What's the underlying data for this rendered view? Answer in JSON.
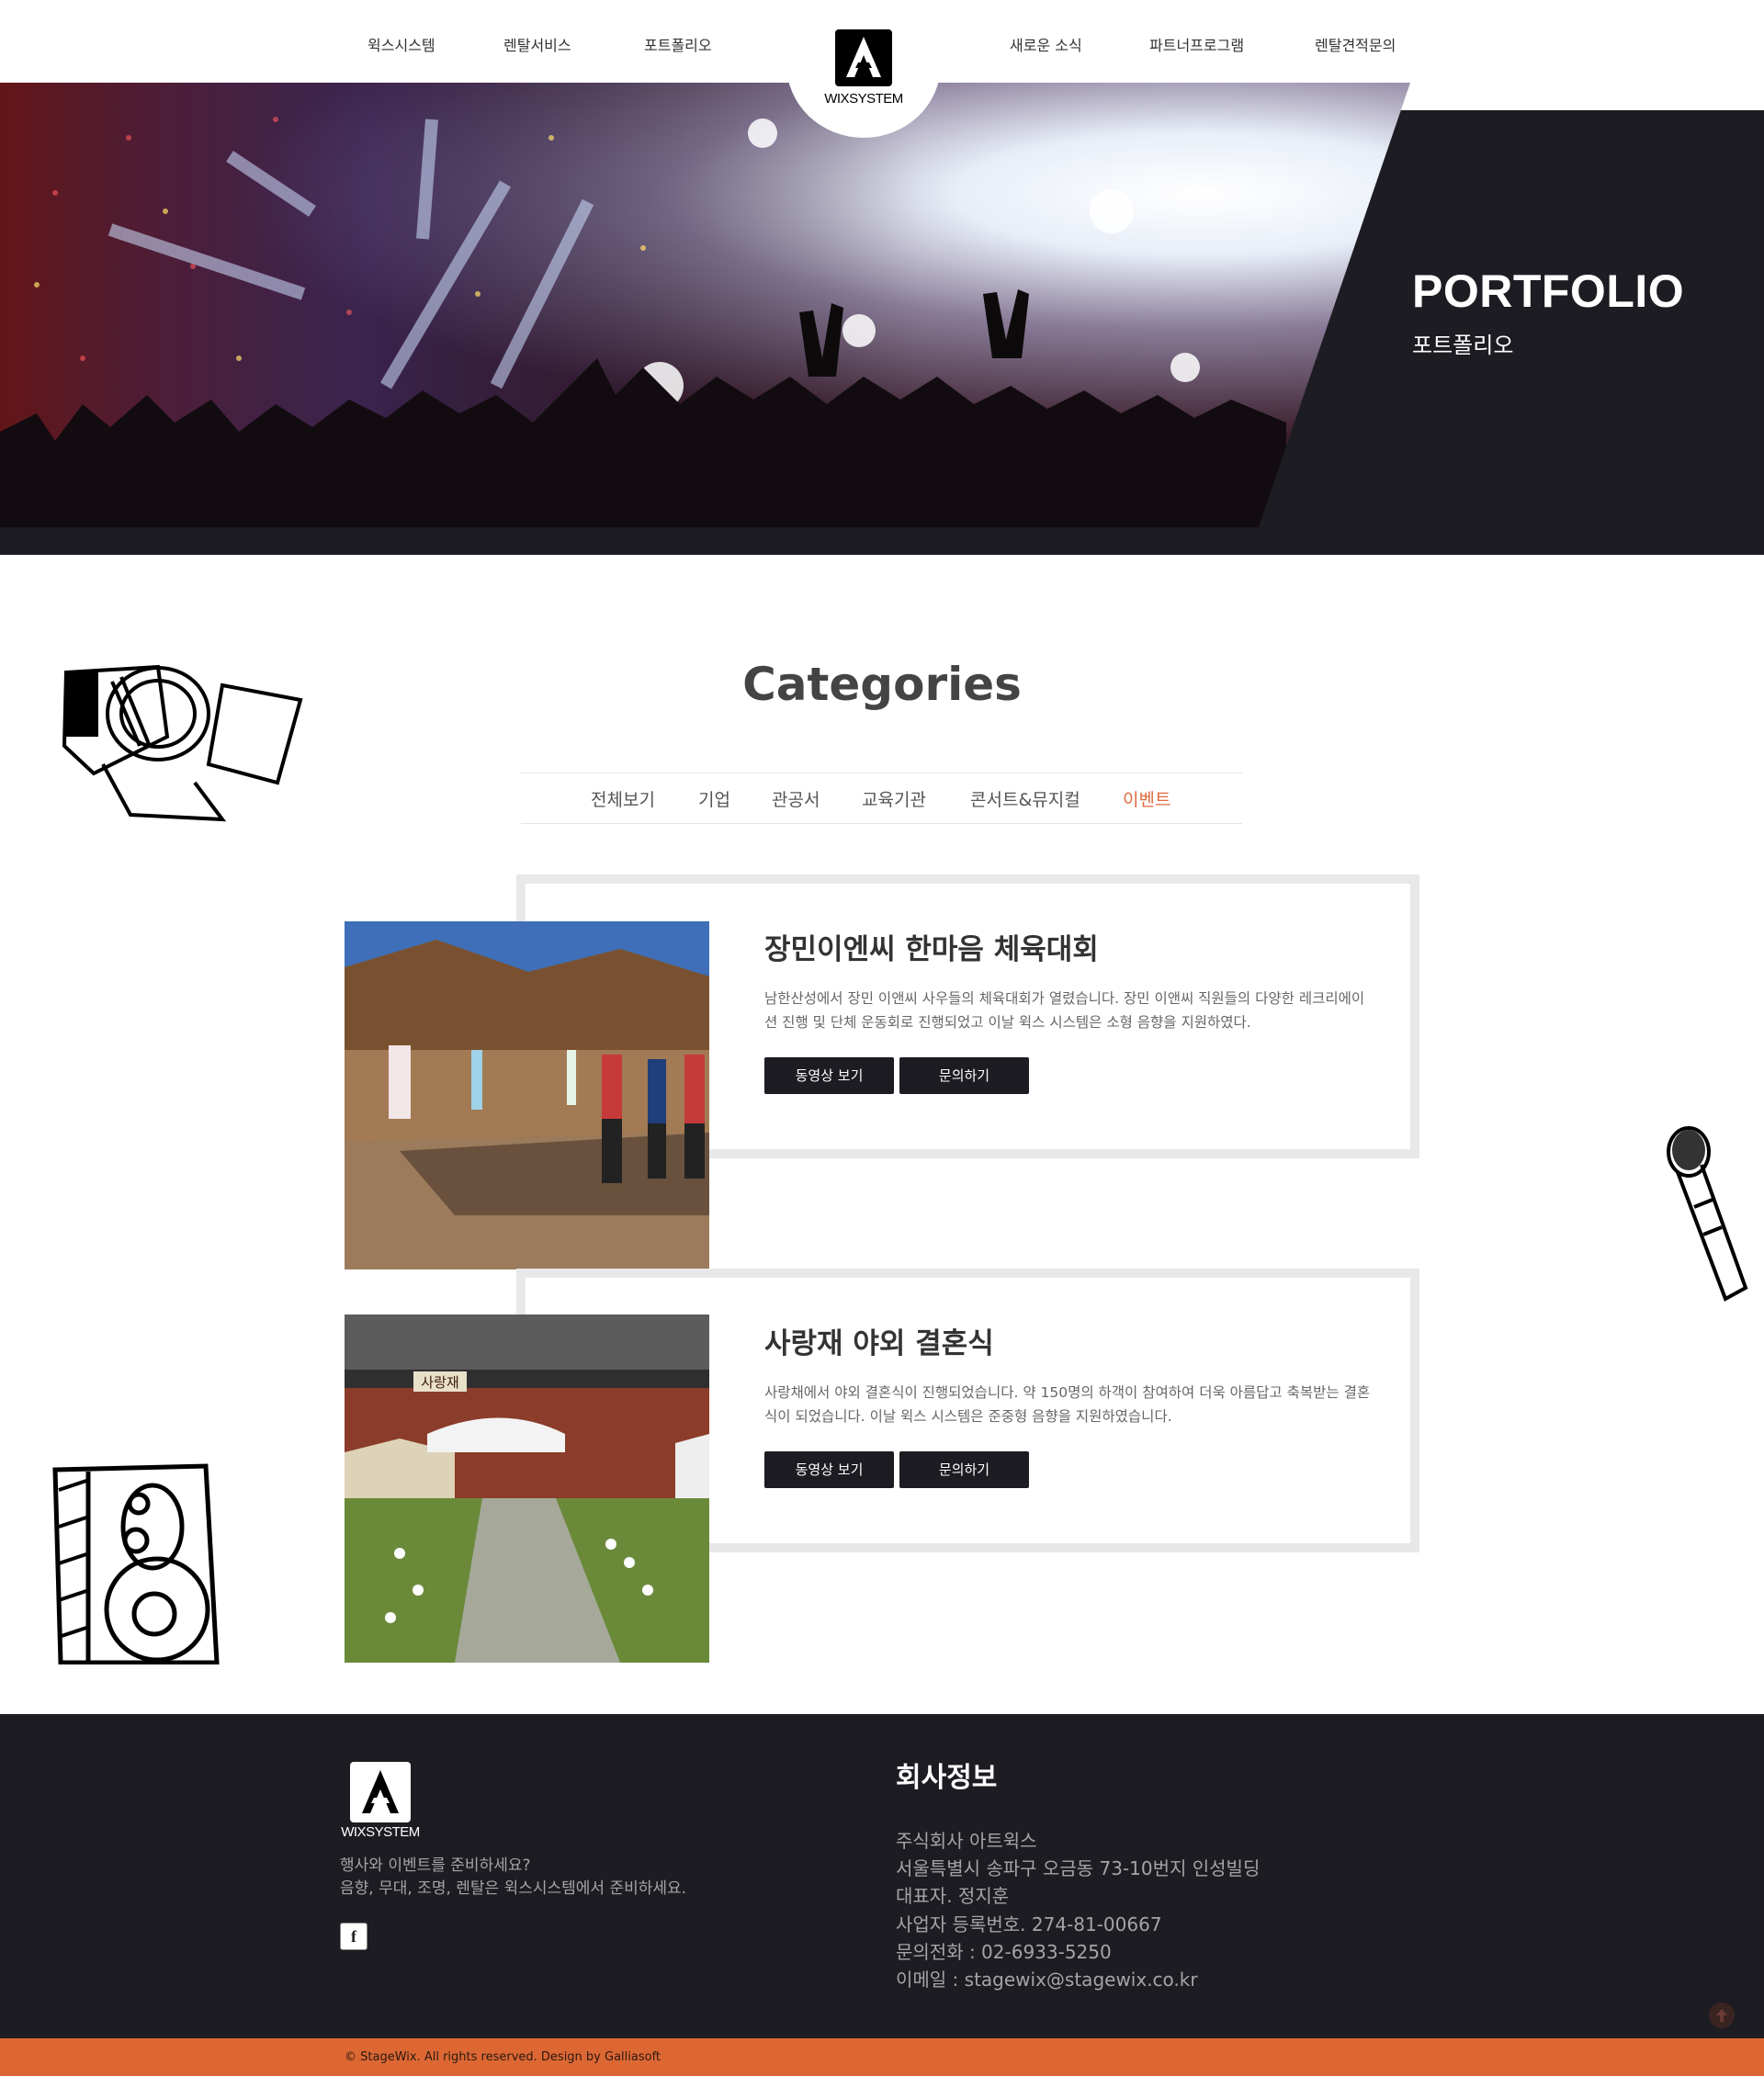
{
  "nav": {
    "left_items": [
      "윅스시스템",
      "렌탈서비스",
      "포트폴리오"
    ],
    "right_items": [
      "새로운 소식",
      "파트너프로그램",
      "렌탈견적문의"
    ],
    "logo_text": "WIXSYSTEM"
  },
  "hero": {
    "title": "PORTFOLIO",
    "subtitle": "포트폴리오"
  },
  "categories": {
    "title": "Categories",
    "items": [
      "전체보기",
      "기업",
      "관공서",
      "교육기관",
      "콘서트&뮤지컬",
      "이벤트"
    ],
    "active": "이벤트"
  },
  "posts": [
    {
      "title": "장민이엔씨 한마음 체육대회",
      "desc": "남한산성에서 장민 이앤씨 사우들의 체육대회가 열렸습니다. 장민 이앤씨 직원들의 다양한 레크리에이션 진행 및 단체 운동회로 진행되었고 이날 윅스 시스템은 소형 음향을 지원하였다.",
      "video_label": "동영상 보기",
      "inquiry_label": "문의하기"
    },
    {
      "title": "사랑재 야외 결혼식",
      "desc": "사랑채에서 야외 결혼식이 진행되었습니다. 약 150명의 하객이 참여하여 더욱 아름답고 축복받는 결혼식이 되었습니다. 이날 윅스 시스템은 준중형 음향을 지원하였습니다.",
      "video_label": "동영상 보기",
      "inquiry_label": "문의하기",
      "sign_text": "사랑재"
    }
  ],
  "footer": {
    "logo_text": "WIXSYSTEM",
    "tagline_1": "행사와 이벤트를 준비하세요?",
    "tagline_2": "음향, 무대, 조명, 렌탈은 윅스시스템에서 준비하세요.",
    "facebook": "f",
    "info_title": "회사정보",
    "info_lines": [
      "주식회사 아트윅스",
      "서울특별시 송파구 오금동 73-10번지 인성빌딩",
      "대표자. 정지훈",
      "사업자 등록번호. 274-81-00667",
      "문의전화 : 02-6933-5250",
      "이메일 : stagewix@stagewix.co.kr"
    ],
    "copyright": "© StageWix. All rights reserved. Design by Galliasoft"
  },
  "colors": {
    "dark": "#1c1c22",
    "accent": "#dd6733",
    "active_category": "#e06a3f"
  }
}
